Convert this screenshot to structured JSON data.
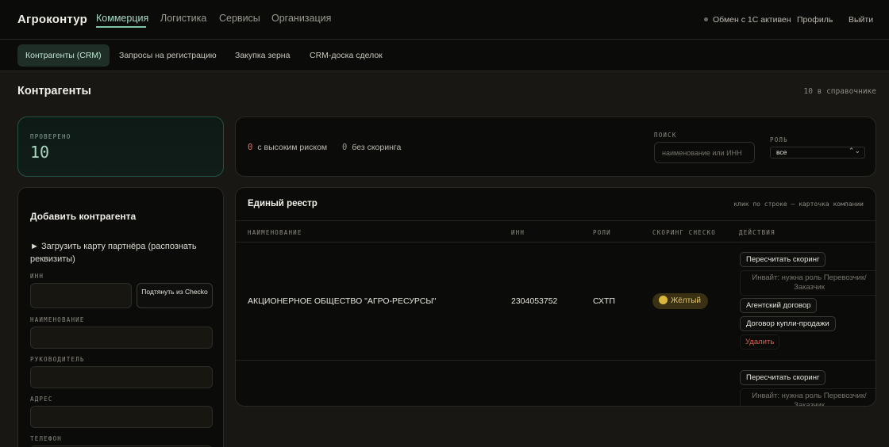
{
  "brand": "Агроконтур",
  "nav": {
    "items": [
      {
        "label": "Коммерция",
        "active": true
      },
      {
        "label": "Логистика",
        "active": false
      },
      {
        "label": "Сервисы",
        "active": false
      },
      {
        "label": "Организация",
        "active": false
      }
    ],
    "status": "Обмен с 1С активен",
    "profile": "Профиль",
    "logout": "Выйти"
  },
  "subnav": {
    "tabs": [
      {
        "label": "Контрагенты (CRM)",
        "active": true
      },
      {
        "label": "Запросы на регистрацию",
        "active": false
      },
      {
        "label": "Закупка зерна",
        "active": false
      },
      {
        "label": "CRM-доска сделок",
        "active": false
      }
    ]
  },
  "page": {
    "title": "Контрагенты",
    "count": "10 в справочнике"
  },
  "stat": {
    "label": "ПРОВЕРЕНО",
    "value": "10"
  },
  "filters": {
    "high_risk_count": "0",
    "high_risk_label": "с высоким риском",
    "no_scoring_count": "0",
    "no_scoring_label": "без скоринга",
    "search_label": "ПОИСК",
    "search_placeholder": "наименование или ИНН",
    "role_label": "РОЛЬ",
    "role_value": "все"
  },
  "form": {
    "title": "Добавить контрагента",
    "upload": "► Загрузить карту партнёра (распознать реквизиты)",
    "inn_label": "ИНН",
    "checko_button": "Подтянуть из Checko",
    "name_label": "НАИМЕНОВАНИЕ",
    "director_label": "РУКОВОДИТЕЛЬ",
    "address_label": "АДРЕС",
    "phone_label": "ТЕЛЕФОН"
  },
  "registry": {
    "title": "Единый реестр",
    "hint": "клик по строке — карточка компании",
    "columns": [
      "НАИМЕНОВАНИЕ",
      "ИНН",
      "РОЛИ",
      "СКОРИНГ CHECKO",
      "ДЕЙСТВИЯ"
    ],
    "rows": [
      {
        "name": "АКЦИОНЕРНОЕ ОБЩЕСТВО \"АГРО-РЕСУРСЫ\"",
        "inn": "2304053752",
        "roles": "СХТП",
        "scoring": "Жёлтый",
        "actions": {
          "rescore": "Пересчитать скоринг",
          "invite": "Инвайт: нужна роль Перевозчик/Заказчик",
          "agency": "Агентский договор",
          "sale": "Договор купли-продажи",
          "delete": "Удалить"
        }
      },
      {
        "name": "",
        "inn": "",
        "roles": "",
        "scoring": "",
        "actions": {
          "rescore": "Пересчитать скоринг",
          "invite": "Инвайт: нужна роль Перевозчик/Заказчик"
        }
      }
    ]
  },
  "colors": {
    "accent": "#7fc6a6",
    "danger": "#e2725b",
    "warning": "#d9b73f"
  }
}
